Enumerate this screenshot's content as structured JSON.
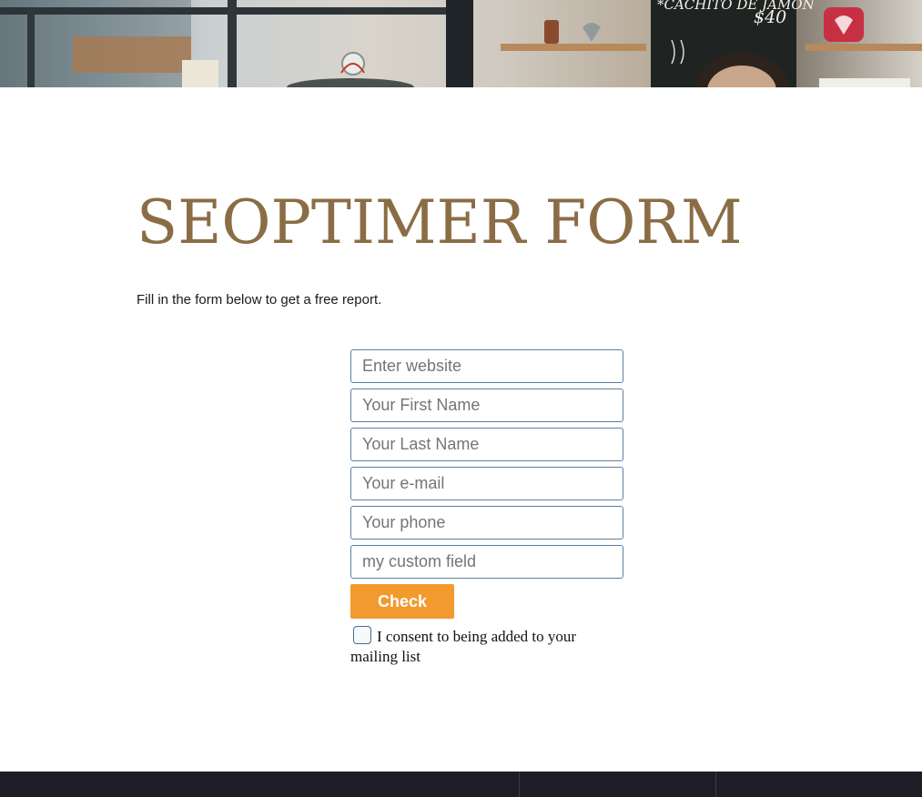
{
  "hero": {
    "chalkboard_line1": "*CACHITO DE JAMÓN",
    "chalkboard_line2": "$40"
  },
  "page": {
    "title": "SEOPTIMER FORM",
    "intro": "Fill in the form below to get a free report."
  },
  "form": {
    "fields": [
      {
        "name": "website",
        "placeholder": "Enter website",
        "value": ""
      },
      {
        "name": "first_name",
        "placeholder": "Your First Name",
        "value": ""
      },
      {
        "name": "last_name",
        "placeholder": "Your Last Name",
        "value": ""
      },
      {
        "name": "email",
        "placeholder": "Your e-mail",
        "value": ""
      },
      {
        "name": "phone",
        "placeholder": "Your phone",
        "value": ""
      },
      {
        "name": "custom",
        "placeholder": "my custom field",
        "value": ""
      }
    ],
    "submit_label": "Check",
    "consent_label": "I consent to being added to your mailing list",
    "consent_checked": false
  },
  "colors": {
    "title": "#8b6d45",
    "button": "#f29a2e",
    "input_border": "#5d7ea0",
    "footer": "#1e1e26"
  }
}
